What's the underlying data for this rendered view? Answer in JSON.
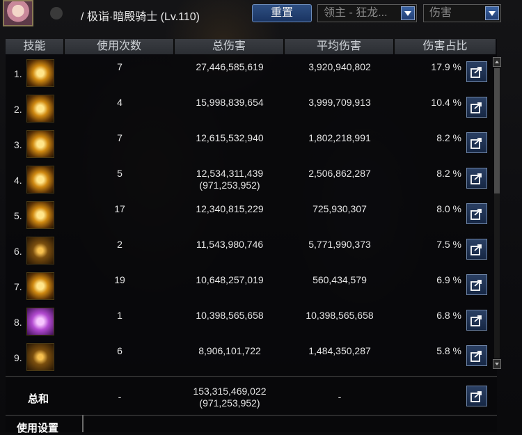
{
  "header": {
    "char_name": "/ 极诣·暗殿骑士 (Lv.110)",
    "reset_label": "重置",
    "target_select": "领主 - 狂龙...",
    "metric_select": "伤害"
  },
  "columns": {
    "skill": "技能",
    "count": "使用次数",
    "total": "总伤害",
    "avg": "平均伤害",
    "pct": "伤害占比"
  },
  "rows": [
    {
      "rank": "1.",
      "count": "7",
      "total": "27,446,585,619",
      "total_extra": "",
      "avg": "3,920,940,802",
      "pct": "17.9 %",
      "icon": "golden-beam-skill-icon"
    },
    {
      "rank": "2.",
      "count": "4",
      "total": "15,998,839,654",
      "total_extra": "",
      "avg": "3,999,709,913",
      "pct": "10.4 %",
      "icon": "golden-orb-skill-icon"
    },
    {
      "rank": "3.",
      "count": "7",
      "total": "12,615,532,940",
      "total_extra": "",
      "avg": "1,802,218,991",
      "pct": "8.2 %",
      "icon": "golden-blades-skill-icon"
    },
    {
      "rank": "4.",
      "count": "5",
      "total": "12,534,311,439",
      "total_extra": "(971,253,952)",
      "avg": "2,506,862,287",
      "pct": "8.2 %",
      "icon": "golden-burst-skill-icon"
    },
    {
      "rank": "5.",
      "count": "17",
      "total": "12,340,815,229",
      "total_extra": "",
      "avg": "725,930,307",
      "pct": "8.0 %",
      "icon": "golden-figure-skill-icon"
    },
    {
      "rank": "6.",
      "count": "2",
      "total": "11,543,980,746",
      "total_extra": "",
      "avg": "5,771,990,373",
      "pct": "7.5 %",
      "icon": "golden-sun-skill-icon"
    },
    {
      "rank": "7.",
      "count": "19",
      "total": "10,648,257,019",
      "total_extra": "",
      "avg": "560,434,579",
      "pct": "6.9 %",
      "icon": "golden-slash-skill-icon"
    },
    {
      "rank": "8.",
      "count": "1",
      "total": "10,398,565,658",
      "total_extra": "",
      "avg": "10,398,565,658",
      "pct": "6.8 %",
      "icon": "purple-aura-skill-icon"
    },
    {
      "rank": "9.",
      "count": "6",
      "total": "8,906,101,722",
      "total_extra": "",
      "avg": "1,484,350,287",
      "pct": "5.8 %",
      "icon": "golden-rune-skill-icon"
    }
  ],
  "summary": {
    "label": "总和",
    "count": "-",
    "total": "153,315,469,022",
    "total_extra": "(971,253,952)",
    "avg": "-"
  },
  "footer": {
    "tab_label": "使用设置"
  },
  "colors": {
    "header_bg": "#2b2e33",
    "button_blue": "#1a3462",
    "text": "#e6e6e6"
  }
}
